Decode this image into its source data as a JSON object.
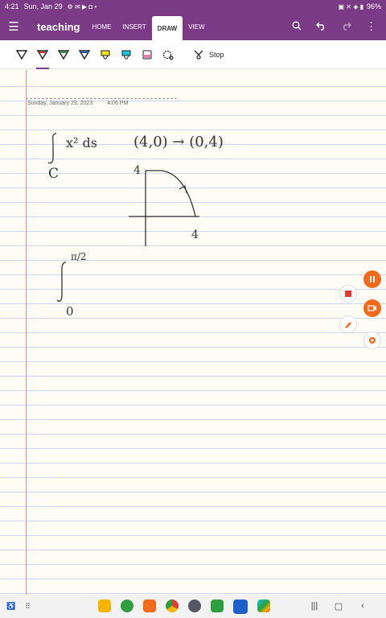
{
  "status": {
    "time": "4:21",
    "date": "Sun, Jan 29",
    "battery": "96%"
  },
  "appbar": {
    "title": "teaching",
    "tabs": [
      {
        "label": "HOME"
      },
      {
        "label": "INSERT"
      },
      {
        "label": "DRAW"
      },
      {
        "label": "VIEW"
      }
    ],
    "active_tab": "DRAW"
  },
  "toolbar": {
    "stop_label": "Stop"
  },
  "note": {
    "date": "Sunday, January 29, 2023",
    "time": "4:06 PM"
  },
  "ink": {
    "line1_integrand": "x² ds",
    "line1_sub": "C",
    "line1_points": "(4,0) → (0,4)",
    "axis_y_label": "4",
    "axis_x_label": "4",
    "int2_upper": "π/2",
    "int2_lower": "0"
  },
  "colors": {
    "accent": "#7a3a86",
    "ruled_line": "#c8d8ef",
    "margin_line": "#f08b8b"
  }
}
